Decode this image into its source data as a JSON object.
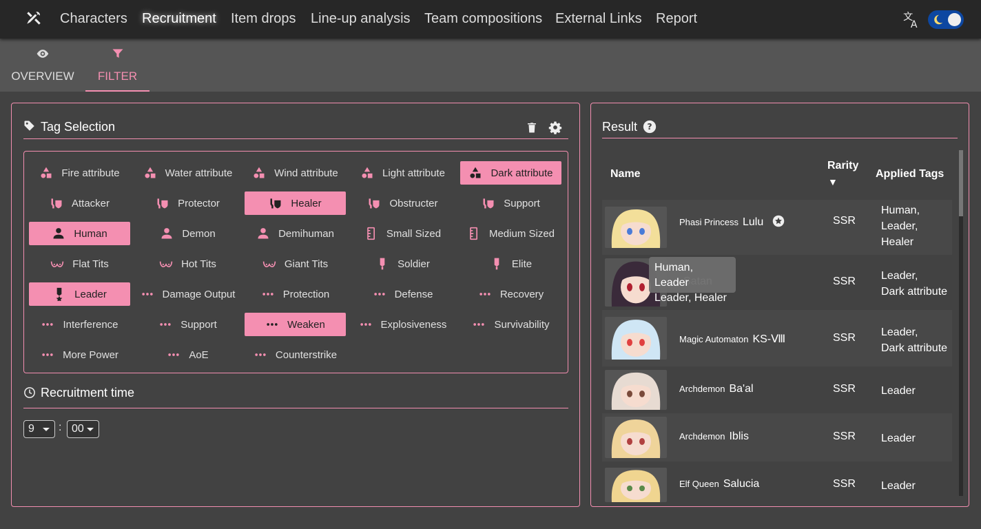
{
  "nav": {
    "links": [
      "Characters",
      "Recruitment",
      "Item drops",
      "Line-up analysis",
      "Team compositions",
      "External Links",
      "Report"
    ],
    "active_index": 1
  },
  "subtabs": [
    {
      "label": "OVERVIEW",
      "icon": "eye-icon"
    },
    {
      "label": "FILTER",
      "icon": "filter-icon"
    }
  ],
  "tag_selection": {
    "title": "Tag Selection",
    "tags": [
      {
        "label": "Fire attribute",
        "icon": "attribute-icon",
        "selected": false
      },
      {
        "label": "Water attribute",
        "icon": "attribute-icon",
        "selected": false
      },
      {
        "label": "Wind attribute",
        "icon": "attribute-icon",
        "selected": false
      },
      {
        "label": "Light attribute",
        "icon": "attribute-icon",
        "selected": false
      },
      {
        "label": "Dark attribute",
        "icon": "attribute-icon",
        "selected": true
      },
      {
        "label": "Attacker",
        "icon": "role-icon",
        "selected": false
      },
      {
        "label": "Protector",
        "icon": "role-icon",
        "selected": false
      },
      {
        "label": "Healer",
        "icon": "role-icon",
        "selected": true
      },
      {
        "label": "Obstructer",
        "icon": "role-icon",
        "selected": false
      },
      {
        "label": "Support",
        "icon": "role-icon",
        "selected": false
      },
      {
        "label": "Human",
        "icon": "person-icon",
        "selected": true
      },
      {
        "label": "Demon",
        "icon": "person-icon",
        "selected": false
      },
      {
        "label": "Demihuman",
        "icon": "person-icon",
        "selected": false
      },
      {
        "label": "Small Sized",
        "icon": "ruler-icon",
        "selected": false
      },
      {
        "label": "Medium Sized",
        "icon": "ruler-icon",
        "selected": false
      },
      {
        "label": "Flat Tits",
        "icon": "bust-icon",
        "selected": false
      },
      {
        "label": "Hot Tits",
        "icon": "bust-icon",
        "selected": false
      },
      {
        "label": "Giant Tits",
        "icon": "bust-icon",
        "selected": false
      },
      {
        "label": "Soldier",
        "icon": "medal-icon",
        "selected": false
      },
      {
        "label": "Elite",
        "icon": "medal-icon",
        "selected": false
      },
      {
        "label": "Leader",
        "icon": "medal-star-icon",
        "selected": true
      },
      {
        "label": "Damage Output",
        "icon": "dots-icon",
        "selected": false
      },
      {
        "label": "Protection",
        "icon": "dots-icon",
        "selected": false
      },
      {
        "label": "Defense",
        "icon": "dots-icon",
        "selected": false
      },
      {
        "label": "Recovery",
        "icon": "dots-icon",
        "selected": false
      },
      {
        "label": "Interference",
        "icon": "dots-icon",
        "selected": false
      },
      {
        "label": "Support",
        "icon": "dots-icon",
        "selected": false
      },
      {
        "label": "Weaken",
        "icon": "dots-icon",
        "selected": true
      },
      {
        "label": "Explosiveness",
        "icon": "dots-icon",
        "selected": false
      },
      {
        "label": "Survivability",
        "icon": "dots-icon",
        "selected": false
      },
      {
        "label": "More Power",
        "icon": "dots-icon",
        "selected": false
      },
      {
        "label": "AoE",
        "icon": "dots-icon",
        "selected": false
      },
      {
        "label": "Counterstrike",
        "icon": "dots-icon",
        "selected": false
      }
    ]
  },
  "recruitment_time": {
    "title": "Recruitment time",
    "hour": "9",
    "separator": ":",
    "minute": "00"
  },
  "result": {
    "title": "Result",
    "columns": {
      "name": "Name",
      "rarity": "Rarity",
      "rarity_sort": "▼",
      "applied": "Applied Tags"
    },
    "rows": [
      {
        "title": "Phasi Princess",
        "name": "Lulu",
        "rarity": "SSR",
        "applied": "Human, Leader, Healer",
        "hair": "#f3df9a",
        "accent": "#4a7bd8"
      },
      {
        "title": "",
        "name": "Satan",
        "rarity": "SSR",
        "applied": "Leader, Dark attribute",
        "hair": "#3a2a3a",
        "accent": "#b02030"
      },
      {
        "title": "Magic Automaton",
        "name": "KS-Ⅷ",
        "rarity": "SSR",
        "applied": "Leader, Dark attribute",
        "hair": "#cfe6f5",
        "accent": "#e04040"
      },
      {
        "title": "Archdemon",
        "name": "Ba'al",
        "rarity": "SSR",
        "applied": "Leader",
        "hair": "#e7dbd2",
        "accent": "#7a4a3a"
      },
      {
        "title": "Archdemon",
        "name": "Iblis",
        "rarity": "SSR",
        "applied": "Leader",
        "hair": "#efd49a",
        "accent": "#b04040"
      },
      {
        "title": "Elf Queen",
        "name": "Salucia",
        "rarity": "SSR",
        "applied": "Leader",
        "hair": "#f0d590",
        "accent": "#5a8a4a"
      }
    ],
    "tooltip": [
      "Human, Leader",
      "Leader, Healer"
    ]
  },
  "colors": {
    "accent": "#f48fb1",
    "toggle": "#0d47a1"
  }
}
